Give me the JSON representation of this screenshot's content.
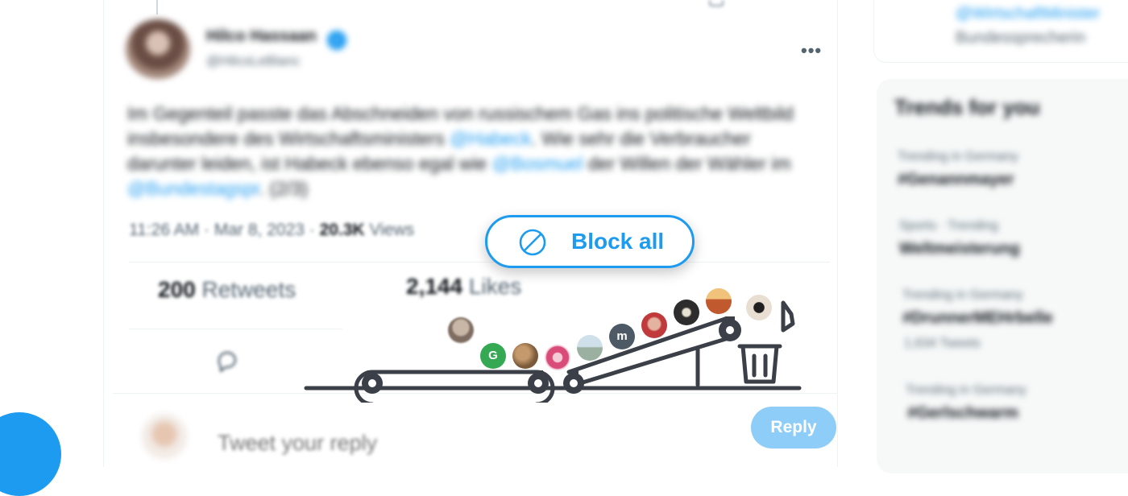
{
  "tweet": {
    "author_name": "Hilco Hassaan",
    "verified_glyph": "✓",
    "author_handle": "@HilcoLeBlanc",
    "more_icon": "more-icon",
    "text_part1": "Im Gegenteil passte das Abschneiden von russischem Gas ins politische Weltbild insbesondere des Wirtschaftsministers",
    "mention1": "@Habeck",
    "text_part2": ". Wie sehr die Verbraucher darunter leiden, ist Habeck ebenso egal wie",
    "mention2": "@Bosmuel",
    "text_part3": "der Willen der Wähler im",
    "mention3": "@Bundestagspr",
    "text_part4": ". (2/3)",
    "time": "11:26 AM",
    "separator": "·",
    "date": "Mar 8, 2023",
    "views_count": "20.3K",
    "views_label": "Views"
  },
  "stats": {
    "retweets_count": "200",
    "retweets_label": "Retweets",
    "likes_count": "2,144",
    "likes_label": "Likes"
  },
  "reply": {
    "placeholder": "Tweet your reply",
    "button_label": "Reply"
  },
  "block_all": {
    "label": "Block all",
    "icon": "block-icon"
  },
  "sidebar": {
    "who_follow_link": "@WirtschaftMinister",
    "who_follow_text": "Bundessprecherin",
    "trends_title": "Trends for you",
    "trends": [
      {
        "meta": "Trending in Germany",
        "name": "#Genannmayer"
      },
      {
        "meta": "Sports · Trending",
        "name": "Weltmeisterung"
      },
      {
        "meta": "Trending in Germany",
        "name": "#DrunnerMEHrbelle",
        "count": "1,634 Tweets"
      },
      {
        "meta": "Trending in Germany",
        "name": "#Gerlschwarm"
      }
    ]
  },
  "conveyor": {
    "letters": [
      "G",
      "m"
    ]
  },
  "colors": {
    "accent": "#1d9bf0",
    "reply_button": "#8ecdf7",
    "illustration": "#3b3f47"
  }
}
